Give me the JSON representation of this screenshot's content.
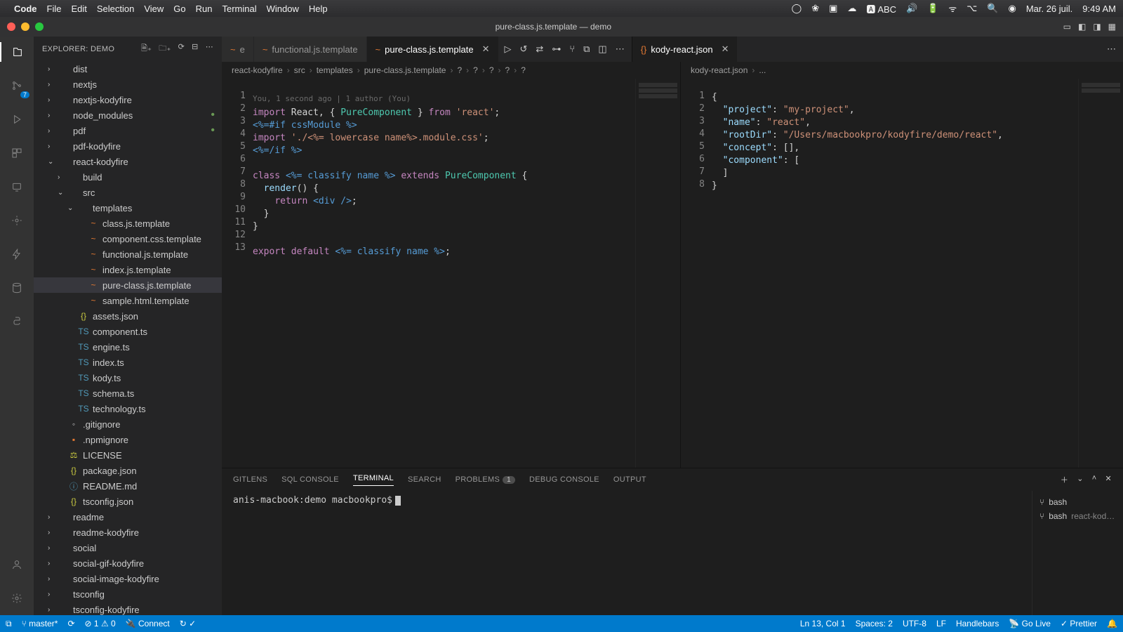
{
  "mac_menu": {
    "apple": "",
    "app": "Code",
    "items": [
      "File",
      "Edit",
      "Selection",
      "View",
      "Go",
      "Run",
      "Terminal",
      "Window",
      "Help"
    ],
    "right": {
      "lang": "ABC",
      "date": "Mar. 26 juil.",
      "time": "9:49 AM"
    }
  },
  "window": {
    "title": "pure-class.js.template — demo"
  },
  "explorer": {
    "header": "EXPLORER: DEMO",
    "tree": [
      {
        "t": "folder",
        "name": "dist",
        "depth": 1
      },
      {
        "t": "folder",
        "name": "nextjs",
        "depth": 1
      },
      {
        "t": "folder",
        "name": "nextjs-kodyfire",
        "depth": 1
      },
      {
        "t": "folder",
        "name": "node_modules",
        "depth": 1,
        "dot": true
      },
      {
        "t": "folder",
        "name": "pdf",
        "depth": 1,
        "dot": true
      },
      {
        "t": "folder",
        "name": "pdf-kodyfire",
        "depth": 1
      },
      {
        "t": "folder",
        "name": "react-kodyfire",
        "depth": 1,
        "open": true
      },
      {
        "t": "folder",
        "name": "build",
        "depth": 2
      },
      {
        "t": "folder",
        "name": "src",
        "depth": 2,
        "open": true
      },
      {
        "t": "folder",
        "name": "templates",
        "depth": 3,
        "open": true
      },
      {
        "t": "file",
        "name": "class.js.template",
        "depth": 4,
        "ic": "ic-orange"
      },
      {
        "t": "file",
        "name": "component.css.template",
        "depth": 4,
        "ic": "ic-orange"
      },
      {
        "t": "file",
        "name": "functional.js.template",
        "depth": 4,
        "ic": "ic-orange"
      },
      {
        "t": "file",
        "name": "index.js.template",
        "depth": 4,
        "ic": "ic-orange"
      },
      {
        "t": "file",
        "name": "pure-class.js.template",
        "depth": 4,
        "ic": "ic-orange",
        "selected": true
      },
      {
        "t": "file",
        "name": "sample.html.template",
        "depth": 4,
        "ic": "ic-orange"
      },
      {
        "t": "file",
        "name": "assets.json",
        "depth": 3,
        "ic": "ic-json",
        "glyph": "{}"
      },
      {
        "t": "file",
        "name": "component.ts",
        "depth": 3,
        "ic": "ic-blue",
        "glyph": "TS"
      },
      {
        "t": "file",
        "name": "engine.ts",
        "depth": 3,
        "ic": "ic-blue",
        "glyph": "TS"
      },
      {
        "t": "file",
        "name": "index.ts",
        "depth": 3,
        "ic": "ic-blue",
        "glyph": "TS"
      },
      {
        "t": "file",
        "name": "kody.ts",
        "depth": 3,
        "ic": "ic-blue",
        "glyph": "TS"
      },
      {
        "t": "file",
        "name": "schema.ts",
        "depth": 3,
        "ic": "ic-blue",
        "glyph": "TS"
      },
      {
        "t": "file",
        "name": "technology.ts",
        "depth": 3,
        "ic": "ic-blue",
        "glyph": "TS"
      },
      {
        "t": "file",
        "name": ".gitignore",
        "depth": 2,
        "glyph": "◦"
      },
      {
        "t": "file",
        "name": ".npmignore",
        "depth": 2,
        "ic": "ic-orange",
        "glyph": "▪"
      },
      {
        "t": "file",
        "name": "LICENSE",
        "depth": 2,
        "ic": "ic-yellow",
        "glyph": "⚖"
      },
      {
        "t": "file",
        "name": "package.json",
        "depth": 2,
        "ic": "ic-json",
        "glyph": "{}"
      },
      {
        "t": "file",
        "name": "README.md",
        "depth": 2,
        "ic": "ic-md",
        "glyph": "ⓘ"
      },
      {
        "t": "file",
        "name": "tsconfig.json",
        "depth": 2,
        "ic": "ic-json",
        "glyph": "{}"
      },
      {
        "t": "folder",
        "name": "readme",
        "depth": 1
      },
      {
        "t": "folder",
        "name": "readme-kodyfire",
        "depth": 1
      },
      {
        "t": "folder",
        "name": "social",
        "depth": 1
      },
      {
        "t": "folder",
        "name": "social-gif-kodyfire",
        "depth": 1
      },
      {
        "t": "folder",
        "name": "social-image-kodyfire",
        "depth": 1
      },
      {
        "t": "folder",
        "name": "tsconfig",
        "depth": 1
      },
      {
        "t": "folder",
        "name": "tsconfig-kodyfire",
        "depth": 1
      }
    ]
  },
  "tabs_left": [
    {
      "name": "e",
      "active": false,
      "icon": "~"
    },
    {
      "name": "functional.js.template",
      "active": false,
      "icon": "~"
    },
    {
      "name": "pure-class.js.template",
      "active": true,
      "icon": "~"
    }
  ],
  "tabs_right": [
    {
      "name": "kody-react.json",
      "active": true,
      "icon": "{}"
    }
  ],
  "breadcrumb_left": [
    "react-kodyfire",
    "src",
    "templates",
    "pure-class.js.template",
    "?",
    "?",
    "?",
    "?",
    "?"
  ],
  "breadcrumb_right": [
    "kody-react.json",
    "..."
  ],
  "blame": "You, 1 second ago | 1 author (You)",
  "code_left_lines": 13,
  "code_right_lines": 8,
  "json_data": {
    "project": "my-project",
    "name": "react",
    "rootDir": "/Users/macbookpro/kodyfire/demo/react"
  },
  "panel": {
    "tabs": [
      "GITLENS",
      "SQL CONSOLE",
      "TERMINAL",
      "SEARCH",
      "PROBLEMS",
      "DEBUG CONSOLE",
      "OUTPUT"
    ],
    "active": "TERMINAL",
    "problems_badge": "1",
    "prompt": "anis-macbook:demo macbookpro$",
    "shells": [
      {
        "name": "bash",
        "extra": ""
      },
      {
        "name": "bash",
        "extra": "react-kod…"
      }
    ]
  },
  "status": {
    "branch": "master*",
    "errors": "1",
    "warnings": "0",
    "connect": "Connect",
    "cursor": "Ln 13, Col 1",
    "spaces": "Spaces: 2",
    "encoding": "UTF-8",
    "eol": "LF",
    "lang": "Handlebars",
    "golive": "Go Live",
    "prettier": "Prettier"
  },
  "activity_badge": "7"
}
